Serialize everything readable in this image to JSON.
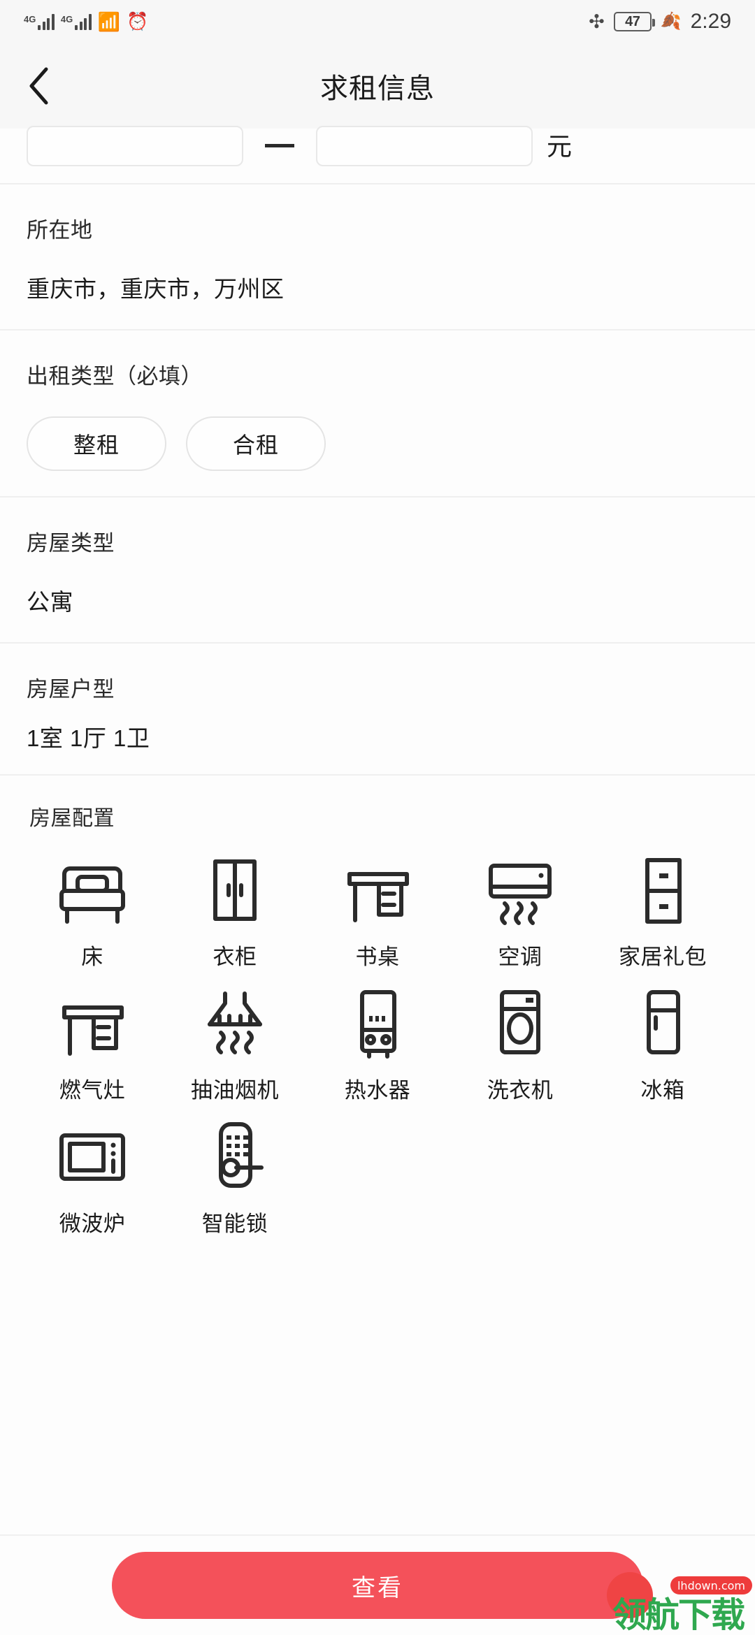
{
  "status_bar": {
    "network_1": "4G",
    "network_2": "4G",
    "wifi_icon": "wifi-icon",
    "alarm_icon": "alarm-clock-icon",
    "bluetooth_icon": "bluetooth-icon",
    "battery_level": "47",
    "power_saving_icon": "leaf-icon",
    "time": "2:29"
  },
  "header": {
    "back_icon": "chevron-left-icon",
    "title": "求租信息"
  },
  "price": {
    "min_value": "",
    "max_value": "",
    "separator": "—",
    "unit": "元"
  },
  "sections": {
    "location": {
      "label": "所在地",
      "value": "重庆市，重庆市，万州区"
    },
    "rent_type": {
      "label": "出租类型（必填）",
      "options": [
        "整租",
        "合租"
      ],
      "selected": ""
    },
    "house_type": {
      "label": "房屋类型",
      "value": "公寓"
    },
    "layout": {
      "label": "房屋户型",
      "value": "1室 1厅 1卫"
    }
  },
  "amenities": {
    "title": "房屋配置",
    "items": [
      {
        "label": "床",
        "icon": "bed-icon"
      },
      {
        "label": "衣柜",
        "icon": "wardrobe-icon"
      },
      {
        "label": "书桌",
        "icon": "desk-icon"
      },
      {
        "label": "空调",
        "icon": "air-conditioner-icon"
      },
      {
        "label": "家居礼包",
        "icon": "cabinet-icon"
      },
      {
        "label": "燃气灶",
        "icon": "gas-stove-icon"
      },
      {
        "label": "抽油烟机",
        "icon": "range-hood-icon"
      },
      {
        "label": "热水器",
        "icon": "water-heater-icon"
      },
      {
        "label": "洗衣机",
        "icon": "washing-machine-icon"
      },
      {
        "label": "冰箱",
        "icon": "refrigerator-icon"
      },
      {
        "label": "微波炉",
        "icon": "microwave-icon"
      },
      {
        "label": "智能锁",
        "icon": "smart-lock-icon"
      }
    ]
  },
  "bottom": {
    "cta_label": "查看",
    "cta_color": "#F4515A"
  },
  "watermark": {
    "text": "领航下载",
    "badge": "lhdown.com",
    "text_color": "#2FA84F",
    "badge_color": "#EE3B3B"
  }
}
